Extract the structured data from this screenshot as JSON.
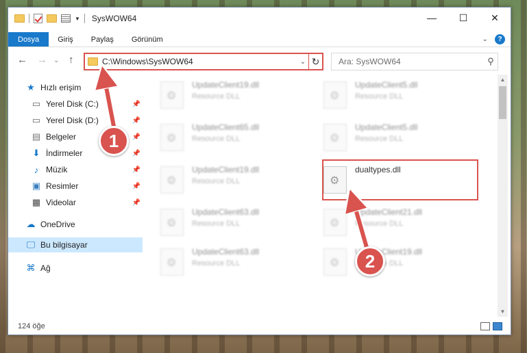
{
  "window": {
    "title": "SysWOW64",
    "controls": {
      "minimize": "—",
      "maximize": "☐",
      "close": "✕"
    }
  },
  "ribbon": {
    "tabs": [
      "Dosya",
      "Giriş",
      "Paylaş",
      "Görünüm"
    ],
    "help_label": "?"
  },
  "nav": {
    "back": "←",
    "forward": "→",
    "up": "↑",
    "address": "C:\\Windows\\SysWOW64",
    "search_placeholder": "Ara: SysWOW64"
  },
  "sidebar": {
    "items": [
      {
        "label": "Hızlı erişim",
        "icon": "star-icon"
      },
      {
        "label": "Yerel Disk (C:)",
        "icon": "drive-icon",
        "pinned": true
      },
      {
        "label": "Yerel Disk (D:)",
        "icon": "drive-icon",
        "pinned": true
      },
      {
        "label": "Belgeler",
        "icon": "documents-icon",
        "pinned": true
      },
      {
        "label": "İndirmeler",
        "icon": "download-icon",
        "pinned": true
      },
      {
        "label": "Müzik",
        "icon": "music-icon",
        "pinned": true
      },
      {
        "label": "Resimler",
        "icon": "pictures-icon",
        "pinned": true
      },
      {
        "label": "Videolar",
        "icon": "video-icon",
        "pinned": true
      },
      {
        "label": "OneDrive",
        "icon": "cloud-icon"
      },
      {
        "label": "Bu bilgisayar",
        "icon": "computer-icon",
        "selected": true
      },
      {
        "label": "Ağ",
        "icon": "network-icon"
      }
    ]
  },
  "files": [
    {
      "name": "UpdateClient19.dll",
      "type": "Resource DLL",
      "blurred": true
    },
    {
      "name": "UpdateClient5.dll",
      "type": "Resource DLL",
      "blurred": true
    },
    {
      "name": "UpdateClient65.dll",
      "type": "Resource DLL",
      "blurred": true
    },
    {
      "name": "UpdateClient5.dll",
      "type": "Resource DLL",
      "blurred": true
    },
    {
      "name": "UpdateClient19.dll",
      "type": "Resource DLL",
      "blurred": true
    },
    {
      "name": "dualtypes.dll",
      "type": "",
      "blurred": false
    },
    {
      "name": "UpdateClient63.dll",
      "type": "Resource DLL",
      "blurred": true
    },
    {
      "name": "UpdateClient21.dll",
      "type": "Resource DLL",
      "blurred": true
    },
    {
      "name": "UpdateClient63.dll",
      "type": "Resource DLL",
      "blurred": true
    },
    {
      "name": "UpdateClient19.dll",
      "type": "Resource DLL",
      "blurred": true
    }
  ],
  "status": {
    "count": "124 öğe"
  },
  "markers": [
    "1",
    "2"
  ],
  "colors": {
    "accent": "#1979ca",
    "annotation": "#d9534f",
    "selected": "#cce8ff"
  }
}
